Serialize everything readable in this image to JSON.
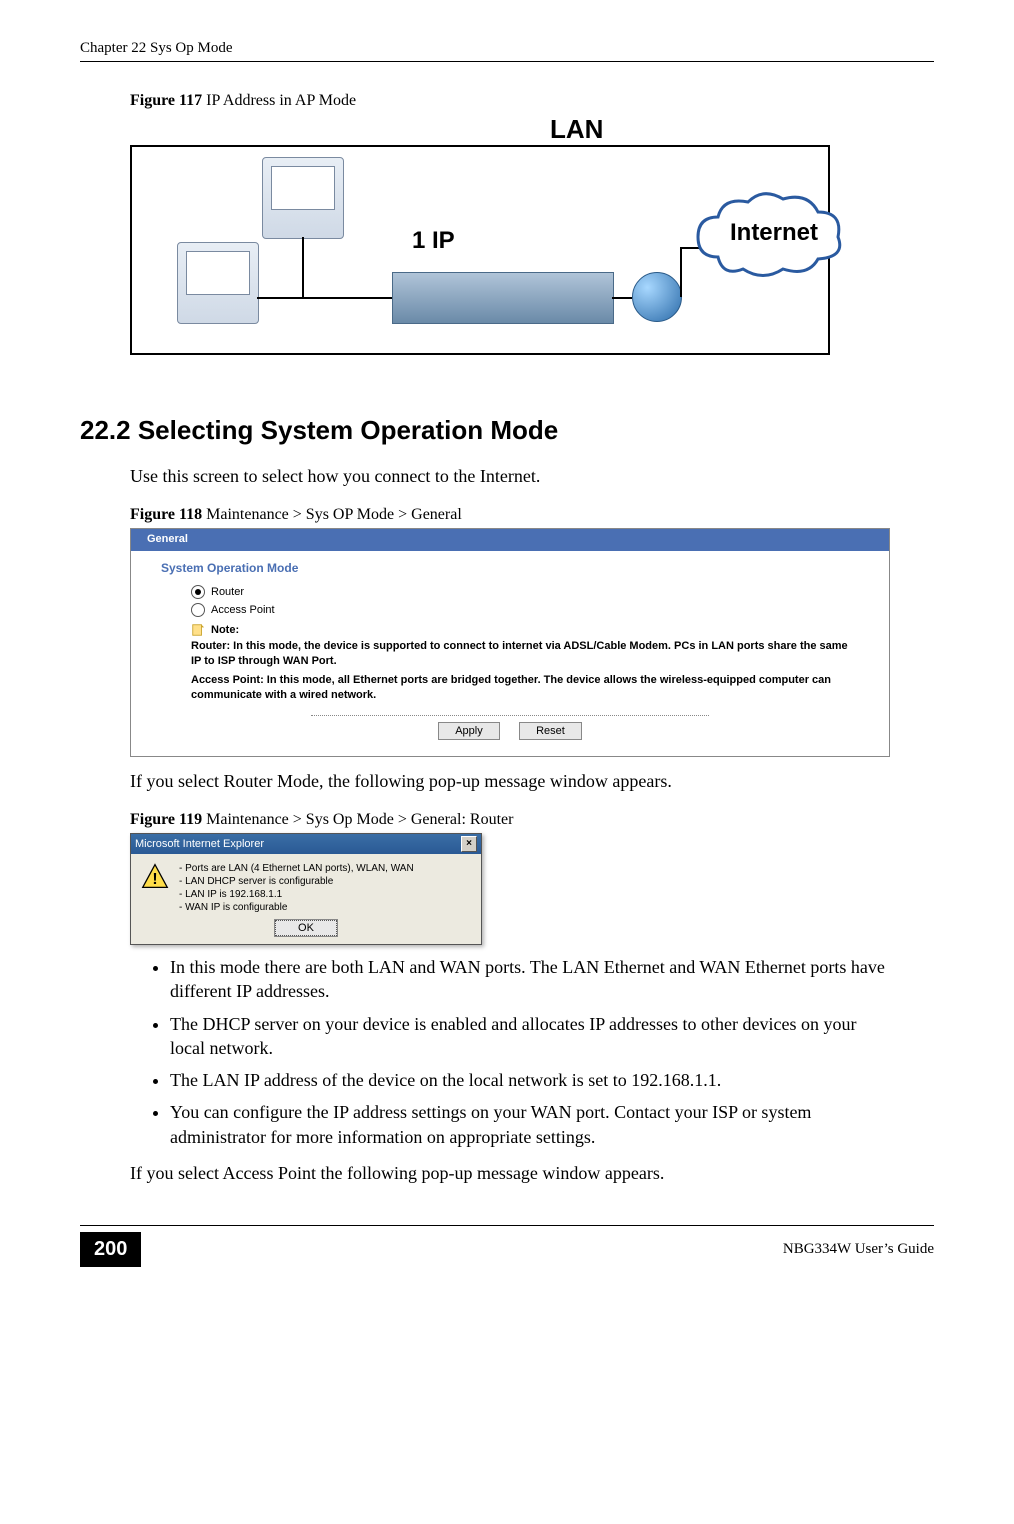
{
  "header": {
    "chapter": "Chapter 22 Sys Op Mode"
  },
  "figure117": {
    "caption_bold": "Figure 117",
    "caption_rest": "   IP Address in AP Mode",
    "lan_label": "LAN",
    "ip_label": "1 IP",
    "internet_label": "Internet"
  },
  "section": {
    "number_title": "22.2  Selecting System Operation Mode",
    "intro": "Use this screen to select how you connect to the Internet."
  },
  "figure118": {
    "caption_bold": "Figure 118",
    "caption_rest": "   Maintenance > Sys OP Mode > General",
    "tab": "General",
    "panel_heading": "System Operation Mode",
    "radio_router": "Router",
    "radio_ap": "Access Point",
    "note_label": "Note:",
    "note_router": "Router: In this mode, the device is supported to connect to internet via ADSL/Cable Modem. PCs in LAN ports share the same IP to ISP through WAN Port.",
    "note_ap": "Access Point: In this mode, all Ethernet ports are bridged together. The device allows the wireless-equipped computer can communicate with a wired network.",
    "apply": "Apply",
    "reset": "Reset"
  },
  "after118": "If you select Router Mode, the following pop-up message window appears.",
  "figure119": {
    "caption_bold": "Figure 119",
    "caption_rest": "   Maintenance > Sys Op Mode > General: Router",
    "title": "Microsoft Internet Explorer",
    "lines": [
      "- Ports are LAN (4 Ethernet LAN ports), WLAN, WAN",
      "- LAN DHCP server is configurable",
      "- LAN IP is 192.168.1.1",
      "- WAN IP is configurable"
    ],
    "ok": "OK"
  },
  "bullets": [
    "In this mode there are both LAN and WAN ports. The LAN Ethernet and WAN Ethernet ports have different IP addresses.",
    "The DHCP server on your device is enabled and allocates IP addresses to other devices on your local network.",
    "The LAN IP address of the device on the local network is set to 192.168.1.1.",
    "You can configure the IP address settings on your WAN port. Contact your ISP or system administrator for more information on appropriate settings."
  ],
  "after_bullets": "If you select Access Point the following pop-up message window appears.",
  "footer": {
    "page": "200",
    "guide": "NBG334W User’s Guide"
  }
}
